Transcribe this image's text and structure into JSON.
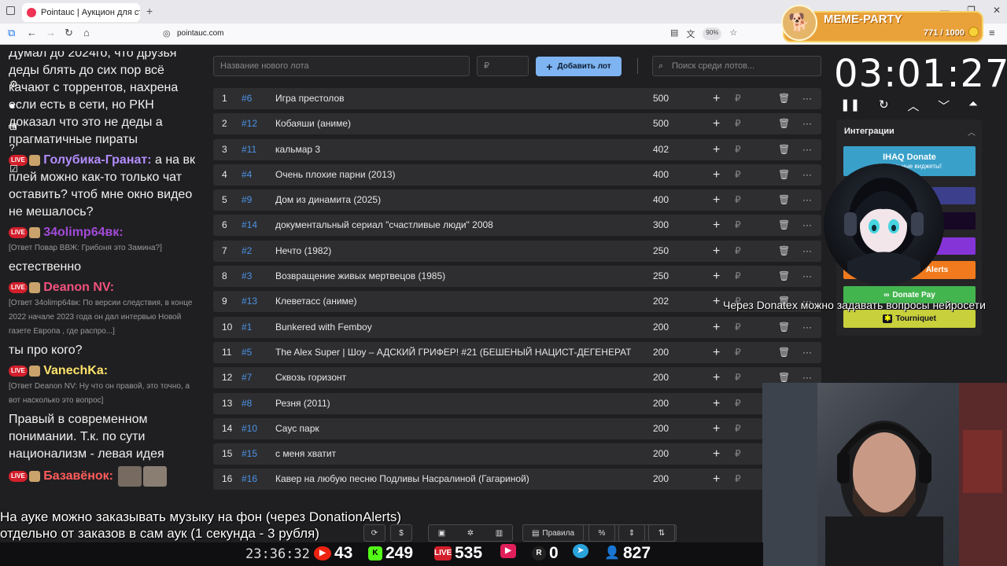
{
  "browser": {
    "tab_title": "Pointauc | Аукцион для стримеров",
    "url": "pointauc.com",
    "zoom": "90%"
  },
  "meme_party": {
    "title": "MEME-PARTY",
    "count": "771 / 1000"
  },
  "chat": {
    "top_message": "Думал до 2024го, что друзья деды блять до сих пор всё качают с торрентов, нахрена если есть в сети, но РКН доказал что это не деды а прагматичные пираты",
    "messages": [
      {
        "user": "Голубика-Гранат",
        "user_color": "#b38cff",
        "text": " а на вк плей можно как-то только чат оставить? чтоб мне окно видео не мешалось?",
        "reply": ""
      },
      {
        "user": "34olimp64вк",
        "user_color": "#a24bd8",
        "text": "естественно",
        "reply": "[Ответ Повар ВВЖ: Грибоня это Замина?]"
      },
      {
        "user": "Deanon NV",
        "user_color": "#f2527d",
        "text": "ты про кого?",
        "reply": "[Ответ 34olimp64вк: По версии следствия, в конце 2022  начале 2023 года он дал интервью Новой газете Европа , где распро...]"
      },
      {
        "user": "VanechKa",
        "user_color": "#ffe36b",
        "text": "Правый в современном понимании. Т.к. по сути национализм - левая идея",
        "reply": "[Ответ Deanon NV: Ну что он правой, это точно, а вот насколько это вопрос]"
      },
      {
        "user": "Базавёнок",
        "user_color": "#ff5c5c",
        "text": "",
        "reply": ""
      }
    ],
    "live_label": "LIVE"
  },
  "form": {
    "lot_name_placeholder": "Название нового лота",
    "price_placeholder": "₽",
    "add_button": "Добавить лот",
    "search_placeholder": "Поиск среди лотов..."
  },
  "lots": [
    {
      "index": "1",
      "id": "#6",
      "name": "Игра престолов",
      "amount": "500"
    },
    {
      "index": "2",
      "id": "#12",
      "name": "Кобаяши (аниме)",
      "amount": "500"
    },
    {
      "index": "3",
      "id": "#11",
      "name": "кальмар 3",
      "amount": "402"
    },
    {
      "index": "4",
      "id": "#4",
      "name": "Очень плохие парни (2013)",
      "amount": "400"
    },
    {
      "index": "5",
      "id": "#9",
      "name": "Дом из динамита (2025)",
      "amount": "400"
    },
    {
      "index": "6",
      "id": "#14",
      "name": "документальный сериал \"счастливые люди\" 2008",
      "amount": "300"
    },
    {
      "index": "7",
      "id": "#2",
      "name": "Нечто (1982)",
      "amount": "250"
    },
    {
      "index": "8",
      "id": "#3",
      "name": "Возвращение живых мертвецов (1985)",
      "amount": "250"
    },
    {
      "index": "9",
      "id": "#13",
      "name": "Клеветасс (аниме)",
      "amount": "202"
    },
    {
      "index": "10",
      "id": "#1",
      "name": "Bunkered with Femboy",
      "amount": "200"
    },
    {
      "index": "11",
      "id": "#5",
      "name": "The Alex Super | Шоу – АДСКИЙ ГРИФЕР! #21 (БЕШЕНЫЙ НАЦИСТ-ДЕГЕНЕРАТ",
      "amount": "200"
    },
    {
      "index": "12",
      "id": "#7",
      "name": "Сквозь горизонт",
      "amount": "200"
    },
    {
      "index": "13",
      "id": "#8",
      "name": "Резня (2011)",
      "amount": "200"
    },
    {
      "index": "14",
      "id": "#10",
      "name": "Саус парк",
      "amount": "200"
    },
    {
      "index": "15",
      "id": "#15",
      "name": "с меня хватит",
      "amount": "200"
    },
    {
      "index": "16",
      "id": "#16",
      "name": "Кавер на любую песню Подливы Насралиной (Гагариной)",
      "amount": "200"
    }
  ],
  "lot_row": {
    "plus": "+",
    "currency": "₽",
    "trash": "🗑",
    "more": "···"
  },
  "timer": {
    "value": "03:01:27"
  },
  "integrations": {
    "title": "Интеграции",
    "ihaq_title": "IHAQ Donate",
    "ihaq_sub": "Уникальные виджеты!",
    "alerts": "Alerts",
    "donatepay": "Donate Pay",
    "tourniquet": "Tourniquet"
  },
  "overlays": {
    "donatex_text": "Через Donatex можно задавать вопросы нейросети",
    "auk_line1": "На ауке можно заказывать музыку на фон (через DonationAlerts)",
    "auk_line2": "отдельно от заказов в сам аук (1 секунда - 3 рубля)"
  },
  "bottom_toolbar": {
    "rules": "Правила"
  },
  "status": {
    "clock": "23:36:32",
    "youtube": "43",
    "kick": "249",
    "vklive": "535",
    "rutube": "0",
    "telegram": "",
    "viewers": "827"
  }
}
